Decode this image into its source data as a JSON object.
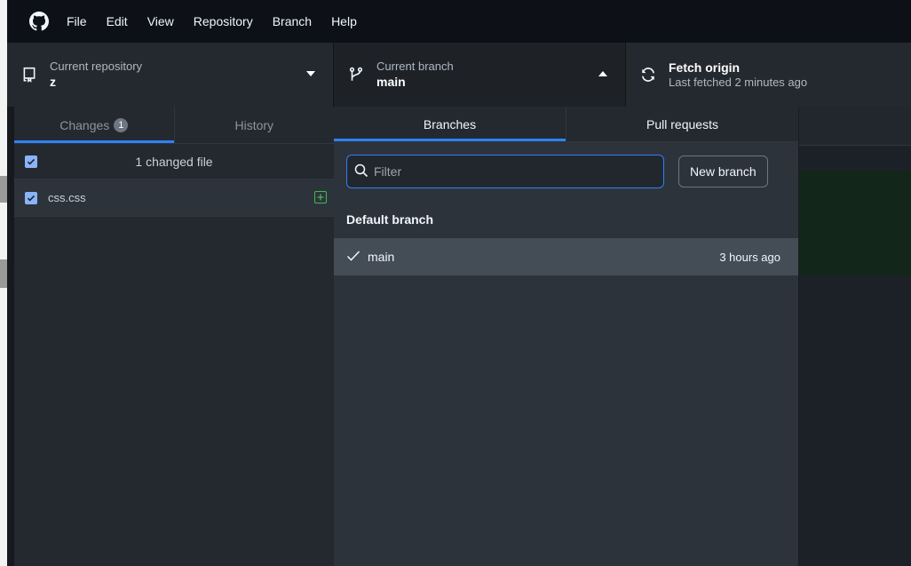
{
  "menubar": {
    "items": [
      "File",
      "Edit",
      "View",
      "Repository",
      "Branch",
      "Help"
    ]
  },
  "toolbar": {
    "repo": {
      "label": "Current repository",
      "value": "z"
    },
    "branch": {
      "label": "Current branch",
      "value": "main"
    },
    "fetch": {
      "label": "Fetch origin",
      "sub": "Last fetched 2 minutes ago"
    }
  },
  "left_pane": {
    "tabs": [
      {
        "label": "Changes",
        "count": "1"
      },
      {
        "label": "History"
      }
    ],
    "header": "1 changed file",
    "files": [
      {
        "name": "css.css"
      }
    ]
  },
  "branch_dropdown": {
    "tabs": [
      "Branches",
      "Pull requests"
    ],
    "filter_placeholder": "Filter",
    "new_branch_label": "New branch",
    "group_label": "Default branch",
    "branches": [
      {
        "name": "main",
        "time": "3 hours ago"
      }
    ]
  },
  "colors": {
    "accent": "#2f81f7",
    "added": "#3fb950"
  }
}
